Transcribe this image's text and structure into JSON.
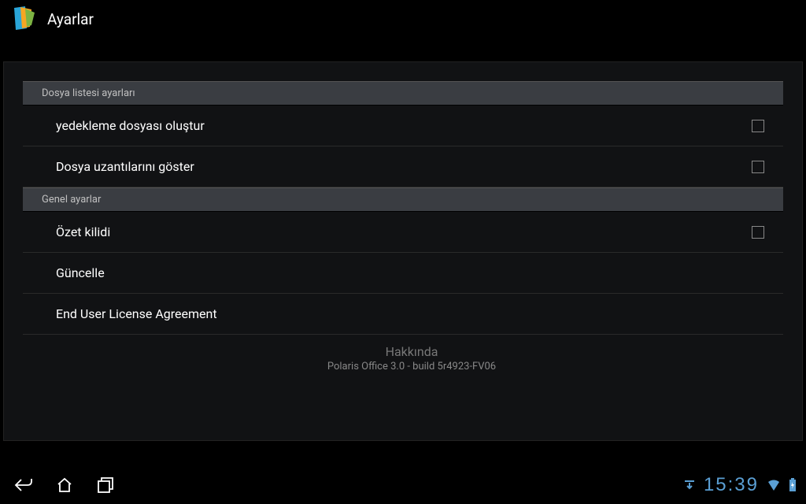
{
  "header": {
    "title": "Ayarlar"
  },
  "sections": {
    "file_list": {
      "title": "Dosya listesi ayarları",
      "backup_label": "yedekleme dosyası oluştur",
      "extensions_label": "Dosya uzantılarını göster"
    },
    "general": {
      "title": "Genel ayarlar",
      "summary_lock_label": "Özet kilidi",
      "update_label": "Güncelle",
      "eula_label": "End User License Agreement",
      "about_label": "Hakkında",
      "about_sub": "Polaris Office 3.0 - build 5r4923-FV06"
    }
  },
  "navbar": {
    "clock": "15:39"
  }
}
